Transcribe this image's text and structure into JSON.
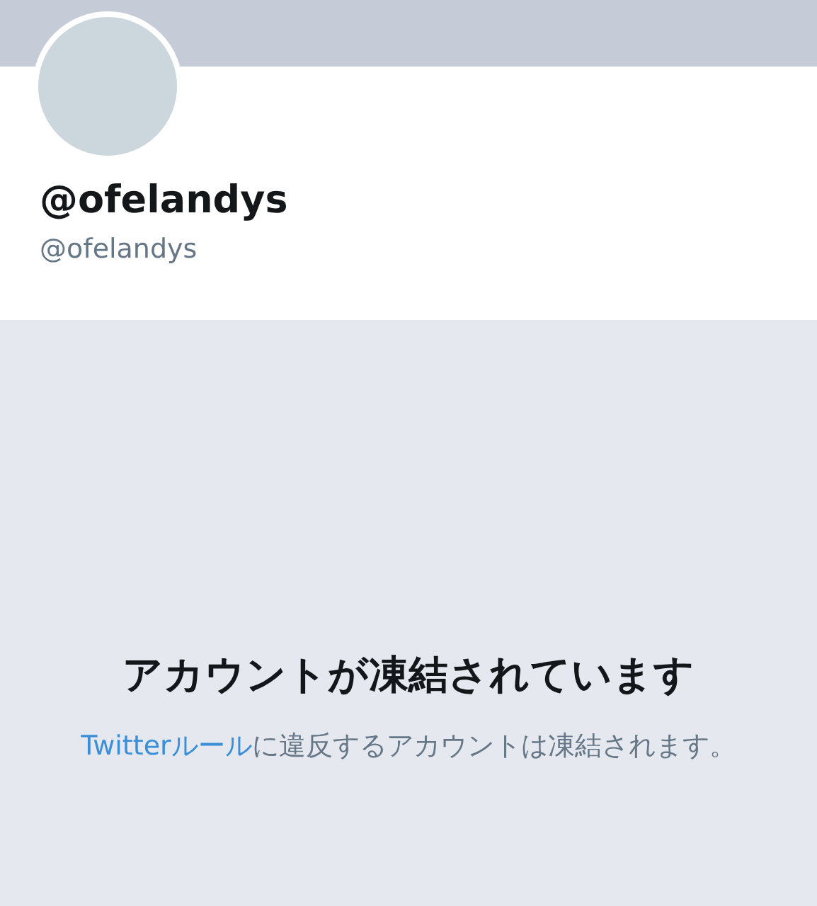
{
  "profile": {
    "display_name": "@ofelandys",
    "handle": "@ofelandys"
  },
  "notice": {
    "title": "アカウントが凍結されています",
    "link": "Twitterルール",
    "text": "に違反するアカウントは凍結されます。"
  }
}
